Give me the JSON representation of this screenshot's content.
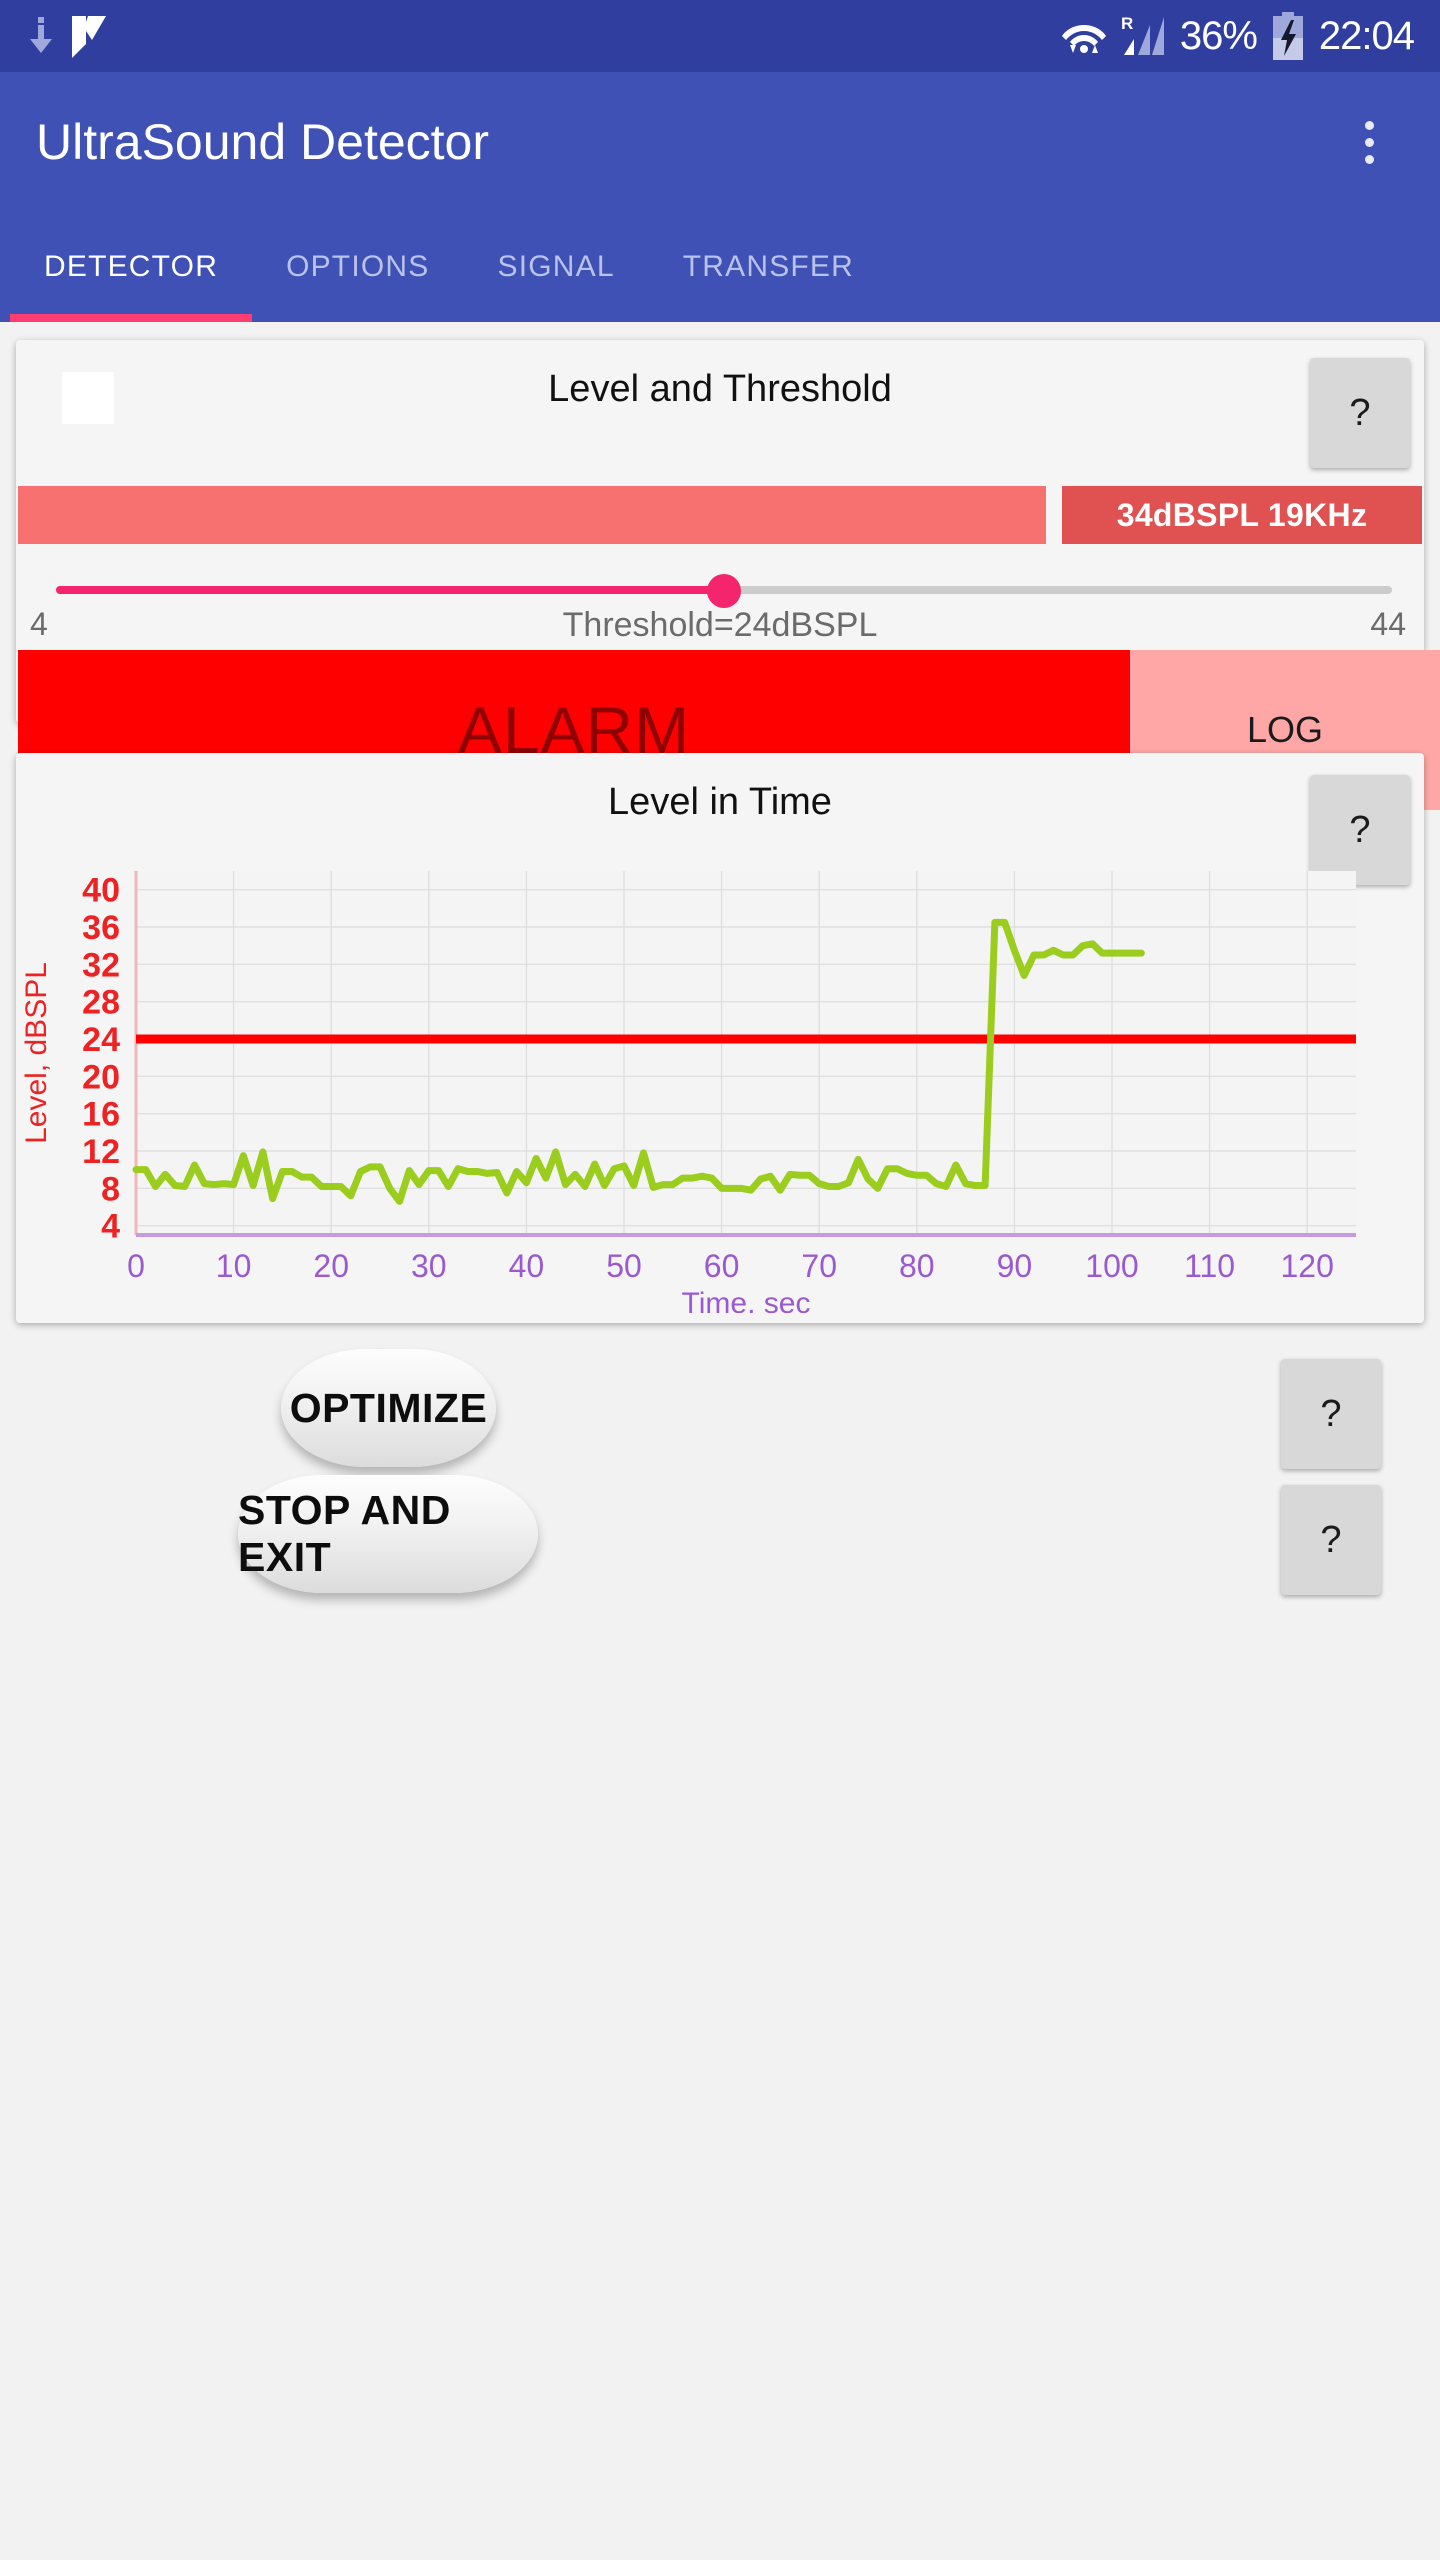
{
  "status_bar": {
    "icons": [
      "download-icon",
      "app-badge-icon",
      "wifi-icon",
      "cellular-roaming-icon",
      "battery-charging-icon"
    ],
    "roaming_letter": "R",
    "battery_percent": "36%",
    "clock": "22:04"
  },
  "app_bar": {
    "title": "UltraSound Detector",
    "overflow_menu": "more-options"
  },
  "tabs": [
    {
      "label": "DETECTOR",
      "active": true
    },
    {
      "label": "OPTIONS",
      "active": false
    },
    {
      "label": "SIGNAL",
      "active": false
    },
    {
      "label": "TRANSFER",
      "active": false
    }
  ],
  "level_card": {
    "title": "Level and Threshold",
    "help_label": "?",
    "level_readout": "34dBSPL 19KHz",
    "level_bar_percent": 100,
    "slider": {
      "min_label": "4",
      "max_label": "44",
      "value_label": "Threshold=24dBSPL",
      "min": 4,
      "max": 44,
      "value": 24,
      "fill_percent": 50
    },
    "alarm_label": "ALARM",
    "log_label": "LOG"
  },
  "chart_card": {
    "title": "Level in Time",
    "help_label": "?"
  },
  "chart_data": {
    "type": "line",
    "title": "Level in Time",
    "xlabel": "Time, sec",
    "ylabel": "Level, dBSPL",
    "xlim": [
      0,
      125
    ],
    "ylim": [
      3,
      42
    ],
    "xticks": [
      0,
      10,
      20,
      30,
      40,
      50,
      60,
      70,
      80,
      90,
      100,
      110,
      120
    ],
    "yticks": [
      4,
      8,
      12,
      16,
      20,
      24,
      28,
      32,
      36,
      40
    ],
    "grid": true,
    "legend": "none",
    "axis_colors": {
      "x": "#9b59d0",
      "y": "#ee2222"
    },
    "threshold": {
      "value": 24,
      "color": "#ff0000",
      "label": "Threshold=24dBSPL"
    },
    "series": [
      {
        "name": "Level",
        "color": "#9acd1e",
        "x": [
          0,
          1,
          2,
          3,
          4,
          5,
          6,
          7,
          8,
          9,
          10,
          11,
          12,
          13,
          14,
          15,
          16,
          17,
          18,
          19,
          20,
          21,
          22,
          23,
          24,
          25,
          26,
          27,
          28,
          29,
          30,
          31,
          32,
          33,
          34,
          35,
          36,
          37,
          38,
          39,
          40,
          41,
          42,
          43,
          44,
          45,
          46,
          47,
          48,
          49,
          50,
          51,
          52,
          53,
          54,
          55,
          56,
          57,
          58,
          59,
          60,
          61,
          62,
          63,
          64,
          65,
          66,
          67,
          68,
          69,
          70,
          71,
          72,
          73,
          74,
          75,
          76,
          77,
          78,
          79,
          80,
          81,
          82,
          83,
          84,
          85,
          86,
          87,
          88,
          89,
          90,
          91,
          92,
          93,
          94,
          95,
          96,
          97,
          98,
          99,
          100,
          101,
          102,
          103,
          104
        ],
        "values": [
          10,
          10,
          8.2,
          9.5,
          8.3,
          8.2,
          10.5,
          8.5,
          8.4,
          8.5,
          8.4,
          11.5,
          8.3,
          11.9,
          6.9,
          9.8,
          9.8,
          9.2,
          9.2,
          8.2,
          8.2,
          8.2,
          7.2,
          9.8,
          10.3,
          10.3,
          8,
          6.6,
          9.9,
          8.4,
          9.9,
          9.9,
          8.2,
          10.1,
          9.8,
          9.8,
          9.6,
          9.7,
          7.5,
          9.8,
          8.6,
          11.2,
          9.1,
          11.9,
          8.4,
          9.5,
          8.2,
          10.6,
          8.3,
          10.1,
          10.4,
          8.3,
          11.8,
          8.1,
          8.4,
          8.4,
          9.1,
          9.1,
          9.3,
          9.1,
          8,
          8,
          8,
          7.8,
          9,
          9.3,
          7.8,
          9.5,
          9.4,
          9.4,
          8.5,
          8.2,
          8.2,
          8.6,
          11.1,
          9,
          8,
          10.1,
          10.1,
          9.6,
          9.4,
          9.4,
          8.5,
          8.2,
          10.5,
          8.5,
          8.3,
          8.3,
          36.5,
          36.5,
          33.5,
          30.8,
          33,
          33,
          33.5,
          33,
          33,
          34,
          34.2,
          33.2,
          33.2,
          33.2,
          33.2,
          33.2
        ]
      }
    ]
  },
  "bottom": {
    "optimize_label": "OPTIMIZE",
    "stop_label": "STOP AND EXIT",
    "help_optimize_label": "?",
    "help_stop_label": "?"
  }
}
